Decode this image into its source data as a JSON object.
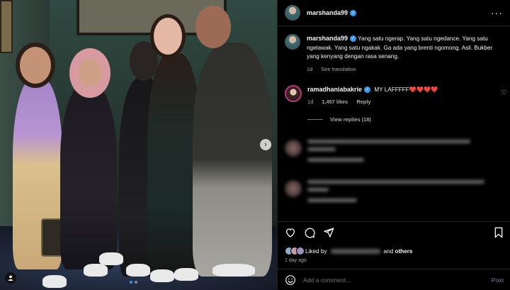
{
  "post": {
    "author": "marshanda99",
    "verified": true,
    "more_icon": "more-horizontal-icon",
    "photo_description_alt": "Group photo",
    "carousel_dots": 2,
    "carousel_active": 0
  },
  "caption": {
    "author": "marshanda99",
    "text": "Yang satu ngerap. Yang satu ngedance. Yang satu ngelawak. Yang satu ngakak. Ga ada yang brenti ngomong. Asli. Bukber yang kenyang dengan rasa senang.",
    "time": "1d",
    "translate": "See translation"
  },
  "comment": {
    "author": "ramadhaniabakrie",
    "text": "MY LAFFFFF❤️❤️❤️❤️",
    "time": "1d",
    "likes": "1,457 likes",
    "reply": "Reply",
    "view_replies": "View replies (18)"
  },
  "actions": {
    "liked_prefix": "Liked by",
    "liked_suffix_and": "and",
    "liked_others": "others",
    "time_ago": "1 day ago"
  },
  "composer": {
    "placeholder": "Add a comment...",
    "post_label": "Post"
  },
  "colors": {
    "background": "#000000",
    "verified": "#3897f0",
    "muted": "#a8a8a8",
    "post_disabled": "#6e7e99"
  }
}
